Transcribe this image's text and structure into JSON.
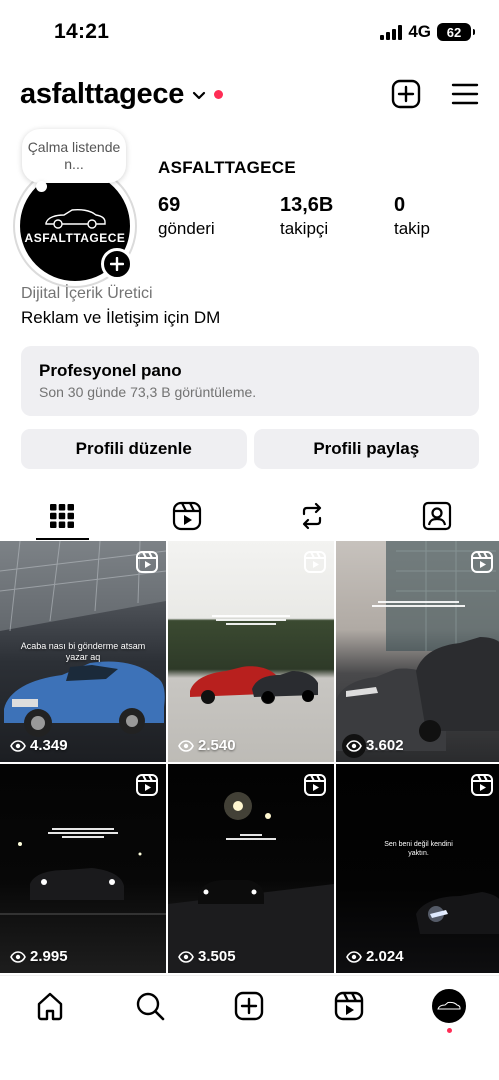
{
  "status_bar": {
    "time": "14:21",
    "network": "4G",
    "battery": "62"
  },
  "header": {
    "username": "asfalttagece"
  },
  "profile": {
    "note": "Çalma listende n...",
    "avatar_text": "ASFALTTAGECE",
    "display_name": "ASFALTTAGECE",
    "stats": [
      {
        "num": "69",
        "label": "gönderi"
      },
      {
        "num": "13,6B",
        "label": "takipçi"
      },
      {
        "num": "0",
        "label": "takip"
      }
    ],
    "category": "Dijital İçerik Üretici",
    "bio": "Reklam ve İletişim için DM"
  },
  "dashboard": {
    "title": "Profesyonel pano",
    "subtitle": "Son 30 günde 73,3 B görüntüleme."
  },
  "buttons": {
    "edit": "Profili düzenle",
    "share": "Profili paylaş"
  },
  "grid": [
    {
      "views": "4.349",
      "overlay": "Acaba nası bi gönderme atsam yazar aq"
    },
    {
      "views": "2.540",
      "overlay": ""
    },
    {
      "views": "3.602",
      "overlay": ""
    },
    {
      "views": "2.995",
      "overlay": ""
    },
    {
      "views": "3.505",
      "overlay": ""
    },
    {
      "views": "2.024",
      "overlay": "Sen beni değil kendini yaktın."
    }
  ],
  "icons": {
    "new_post": "plus-square-icon",
    "menu": "hamburger-menu-icon",
    "tab_grid": "grid-icon",
    "tab_reels": "reels-icon",
    "tab_reposts": "repost-icon",
    "tab_tagged": "tagged-icon",
    "nav_home": "home-icon",
    "nav_search": "search-icon",
    "nav_create": "create-icon",
    "nav_reels": "reels-icon"
  },
  "colors": {
    "accent_red": "#ff2d55",
    "muted": "#737373",
    "button_bg": "#efeff2"
  }
}
